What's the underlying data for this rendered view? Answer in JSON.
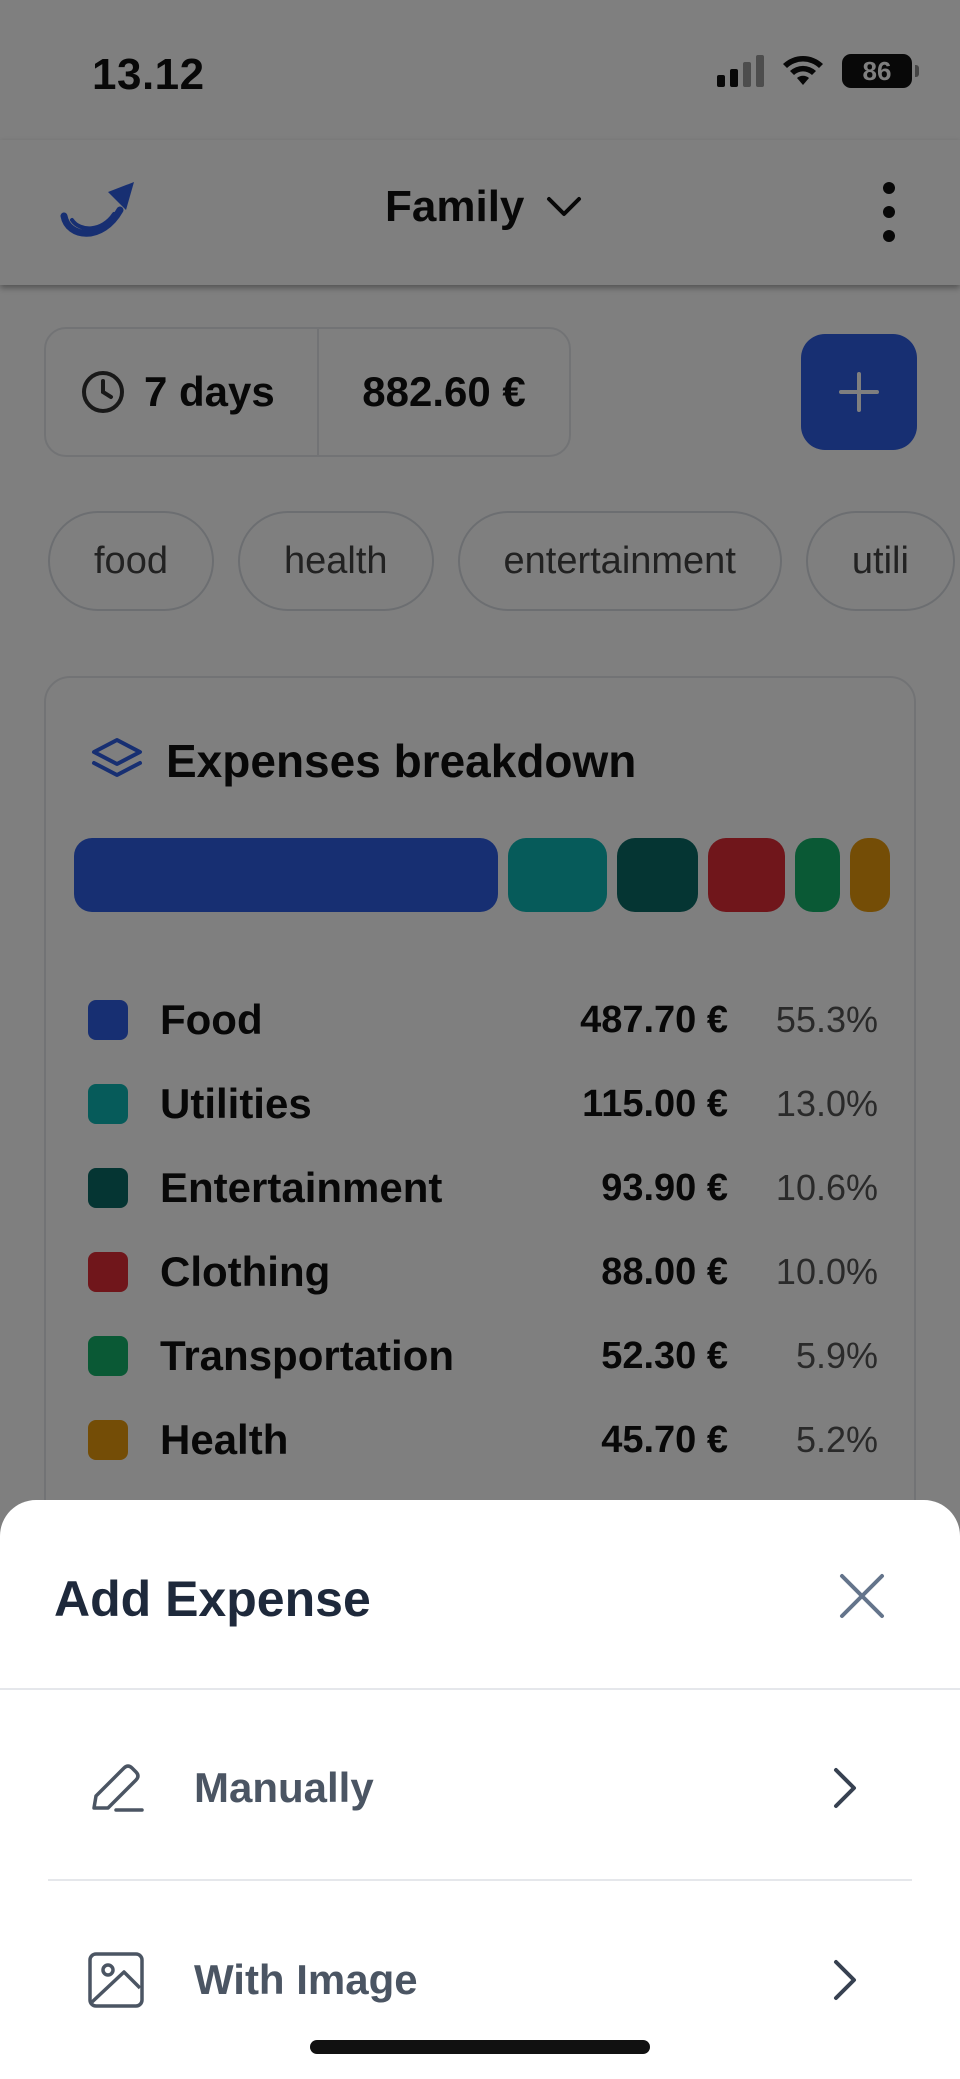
{
  "status_bar": {
    "time": "13.12",
    "battery": "86"
  },
  "header": {
    "title": "Family"
  },
  "summary": {
    "period": "7 days",
    "total": "882.60 €"
  },
  "chips": [
    "food",
    "health",
    "entertainment",
    "utili"
  ],
  "breakdown": {
    "title": "Expenses breakdown",
    "items": [
      {
        "name": "Food",
        "amount": "487.70 €",
        "percent": "55.3%",
        "share": 55.3,
        "color": "#2f5ee4"
      },
      {
        "name": "Utilities",
        "amount": "115.00 €",
        "percent": "13.0%",
        "share": 13.0,
        "color": "#0db7b4"
      },
      {
        "name": "Entertainment",
        "amount": "93.90 €",
        "percent": "10.6%",
        "share": 10.6,
        "color": "#0a6b66"
      },
      {
        "name": "Clothing",
        "amount": "88.00 €",
        "percent": "10.0%",
        "share": 10.0,
        "color": "#e02d37"
      },
      {
        "name": "Transportation",
        "amount": "52.30 €",
        "percent": "5.9%",
        "share": 5.9,
        "color": "#15b26b"
      },
      {
        "name": "Health",
        "amount": "45.70 €",
        "percent": "5.2%",
        "share": 5.2,
        "color": "#e89a0c"
      }
    ]
  },
  "sheet": {
    "title": "Add Expense",
    "options": [
      {
        "label": "Manually",
        "icon": "pencil-icon"
      },
      {
        "label": "With Image",
        "icon": "image-icon"
      }
    ]
  },
  "colors": {
    "accent": "#2f5ee4",
    "sheet_title": "#1e293b",
    "option_text": "#4b5563"
  }
}
